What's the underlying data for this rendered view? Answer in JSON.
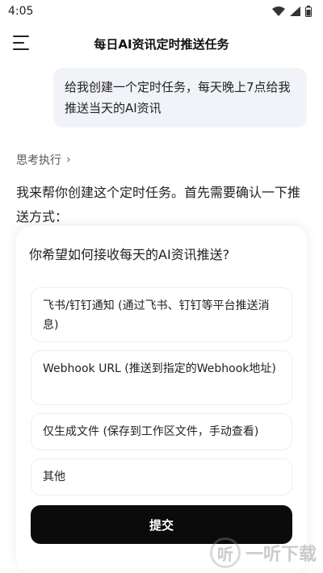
{
  "status_bar": {
    "time": "4:05",
    "icons": [
      "wifi-icon",
      "signal-icon",
      "battery-icon"
    ]
  },
  "header": {
    "title": "每日AI资讯定时推送任务"
  },
  "chat": {
    "user_message": "给我创建一个定时任务，每天晚上7点给我推送当天的AI资讯",
    "think_label": "思考执行",
    "assistant_reply": "我来帮你创建这个定时任务。首先需要确认一下推送方式："
  },
  "sheet": {
    "question": "你希望如何接收每天的AI资讯推送?",
    "options": [
      {
        "label": "飞书/钉钉通知 (通过飞书、钉钉等平台推送消息)"
      },
      {
        "label": "Webhook URL (推送到指定的Webhook地址)"
      },
      {
        "label": "仅生成文件 (保存到工作区文件，手动查看)"
      },
      {
        "label": "其他"
      }
    ],
    "submit_label": "提交"
  },
  "watermark": {
    "text": "一听下载"
  },
  "colors": {
    "bubble_bg": "#f1f3f8",
    "submit_bg": "#0b0b0b"
  }
}
